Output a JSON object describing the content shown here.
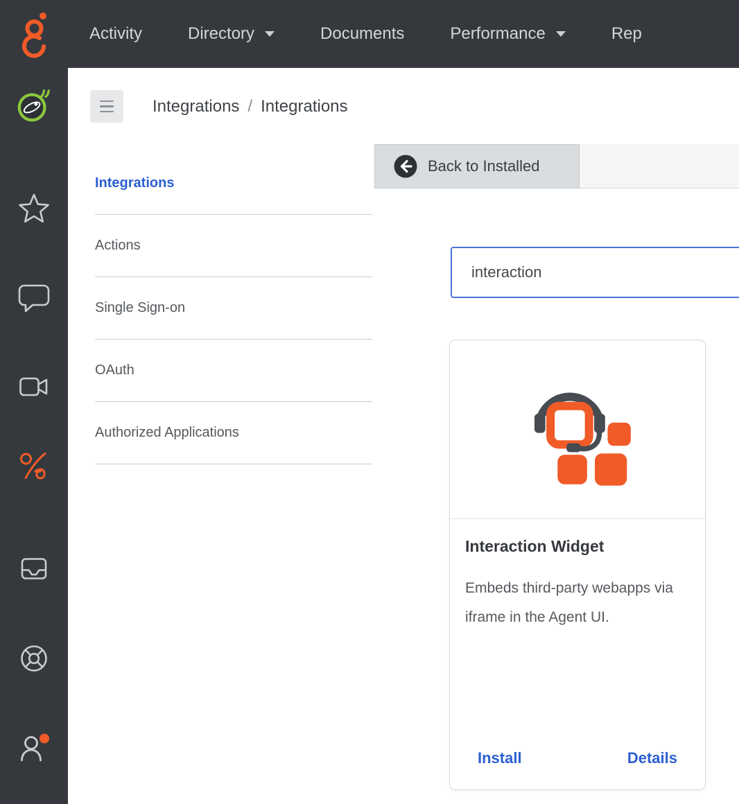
{
  "topnav": {
    "items": [
      {
        "label": "Activity",
        "caret": false
      },
      {
        "label": "Directory",
        "caret": true
      },
      {
        "label": "Documents",
        "caret": false
      },
      {
        "label": "Performance",
        "caret": true
      },
      {
        "label": "Rep",
        "caret": false
      }
    ]
  },
  "sidebar": {
    "icons": [
      "app-logo-icon",
      "star-icon",
      "chat-icon",
      "video-camera-icon",
      "interactions-icon",
      "inbox-icon",
      "support-wheel-icon",
      "profile-status-icon"
    ]
  },
  "breadcrumb": {
    "first": "Integrations",
    "separator": "/",
    "second": "Integrations"
  },
  "side_menu": {
    "items": [
      {
        "label": "Integrations",
        "active": true
      },
      {
        "label": "Actions",
        "active": false
      },
      {
        "label": "Single Sign-on",
        "active": false
      },
      {
        "label": "OAuth",
        "active": false
      },
      {
        "label": "Authorized Applications",
        "active": false
      }
    ]
  },
  "toolbar": {
    "back_button_label": "Back to Installed"
  },
  "search": {
    "value": "interaction"
  },
  "card": {
    "title": "Interaction Widget",
    "description": "Embeds third-party webapps via iframe in the Agent UI.",
    "install_label": "Install",
    "details_label": "Details"
  },
  "colors": {
    "topbar_dark": "#35393e",
    "brand_orange": "#f05b28",
    "accent_blue": "#2b5fd1",
    "logo_green": "#8cc63e",
    "icon_gray": "#c9cccf"
  }
}
